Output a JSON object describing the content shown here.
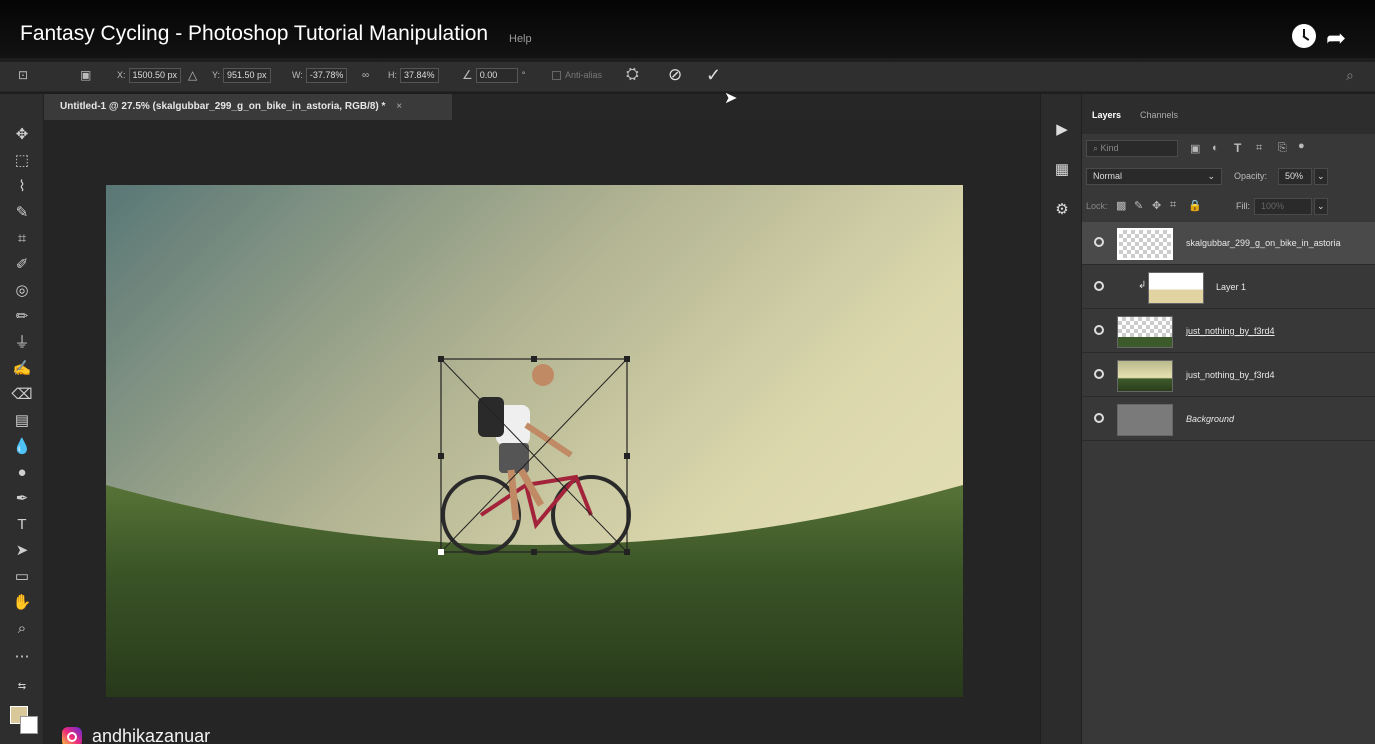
{
  "video": {
    "title": "Fantasy Cycling - Photoshop Tutorial Manipulation",
    "menu_fragment": "Help",
    "channel_handle": "andhikazanuar"
  },
  "options_bar": {
    "x_label": "X:",
    "x_value": "1500.50 px",
    "y_label": "Y:",
    "y_value": "951.50 px",
    "w_label": "W:",
    "w_value": "-37.78%",
    "h_label": "H:",
    "h_value": "37.84%",
    "angle_value": "0.00",
    "angle_unit": "°",
    "anti_alias_label": "Anti-alias"
  },
  "document": {
    "tab_title": "Untitled-1 @ 27.5% (skalgubbar_299_g_on_bike_in_astoria, RGB/8) *",
    "close_glyph": "×"
  },
  "layers_panel": {
    "tabs": [
      {
        "label": "Layers",
        "active": true
      },
      {
        "label": "Channels",
        "active": false
      }
    ],
    "kind_placeholder": "Kind",
    "blend_mode": "Normal",
    "opacity_label": "Opacity:",
    "opacity_value": "50%",
    "lock_label": "Lock:",
    "fill_label": "Fill:",
    "fill_value": "100%",
    "layers": [
      {
        "name": "skalgubbar_299_g_on_bike_in_astoria",
        "selected": true,
        "thumb": "cyclist-transparent"
      },
      {
        "name": "Layer 1",
        "selected": false,
        "thumb": "gradient-clipped",
        "clipped": true
      },
      {
        "name": "just_nothing_by_f3rd4",
        "selected": false,
        "thumb": "grass-transparent",
        "underlined": true
      },
      {
        "name": "just_nothing_by_f3rd4",
        "selected": false,
        "thumb": "sky-grass"
      },
      {
        "name": "Background",
        "selected": false,
        "thumb": "gray",
        "italic": true
      }
    ]
  },
  "colors": {
    "accent_sky": "#e6e2b4",
    "grass": "#3f5a2a",
    "panel_bg": "#383838"
  }
}
